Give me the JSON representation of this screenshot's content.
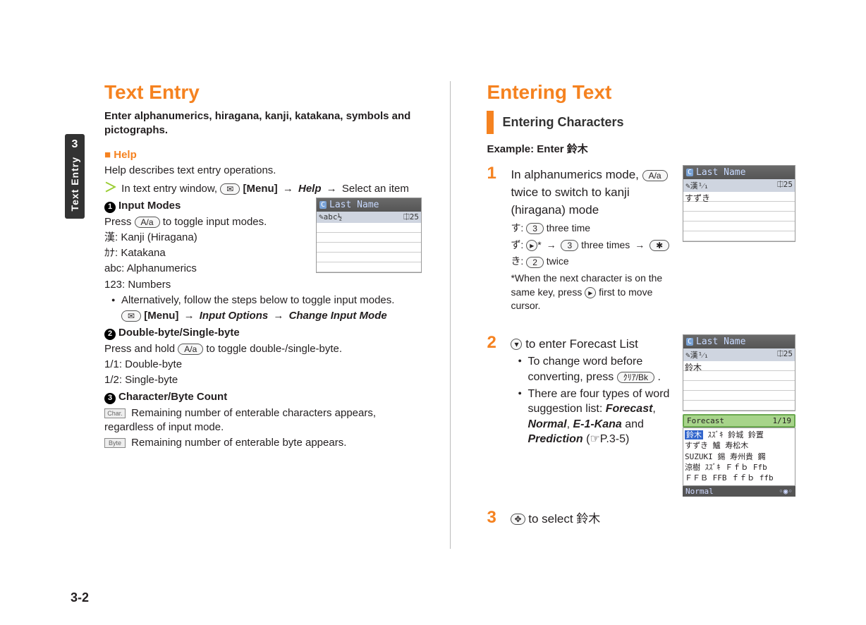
{
  "tab": {
    "chapter_num": "3",
    "chapter_label": "Text Entry"
  },
  "page_number": "3-2",
  "left": {
    "heading": "Text Entry",
    "intro": "Enter alphanumerics, hiragana, kanji, katakana, symbols and pictographs.",
    "help_heading": "Help",
    "help_desc": "Help describes text entry operations.",
    "help_step_prefix": "In text entry window, ",
    "help_step_menu": "[Menu]",
    "help_step_arrow": "→",
    "help_step_help": "Help",
    "help_step_suffix": " Select an item",
    "section1_title": "Input Modes",
    "section1_line1_prefix": "Press ",
    "section1_line1_suffix": " to toggle input modes.",
    "modes": [
      "漢: Kanji (Hiragana)",
      "ｶﾅ: Katakana",
      "abc: Alphanumerics",
      "123: Numbers"
    ],
    "alt_line": "Alternatively, follow the steps below to toggle input modes.",
    "alt_step_menu": "[Menu]",
    "alt_step_opt": "Input Options",
    "alt_step_change": "Change Input Mode",
    "section2_title": "Double-byte/Single-byte",
    "section2_line_prefix": "Press and hold ",
    "section2_line_suffix": " to toggle double-/single-byte.",
    "byte_lines": [
      "1/1: Double-byte",
      "1/2: Single-byte"
    ],
    "section3_title": "Character/Byte Count",
    "char_icon": "Char.",
    "char_line": "Remaining number of enterable characters appears, regardless of input mode.",
    "byte_icon": "Byte",
    "byte_line": "Remaining number of enterable byte appears.",
    "mini": {
      "title": "Last Name",
      "sub_left": "✎abc½",
      "sub_right": "⎅25"
    }
  },
  "right": {
    "heading": "Entering Text",
    "section_bar": "Entering Characters",
    "example": "Example: Enter 鈴木",
    "step1": {
      "num": "1",
      "main_prefix": "In alphanumerics mode, ",
      "main_suffix": " twice to switch to kanji (hiragana) mode",
      "sub_lines": {
        "su": {
          "char": "す: ",
          "key": "3",
          "text": " three time"
        },
        "zu": {
          "char": "ず: ",
          "key1_note": "*",
          "arrow": "→",
          "key2": "3",
          "text_mid": " three times ",
          "key3": "✱"
        },
        "ki": {
          "char": "き: ",
          "key": "2",
          "text": " twice"
        },
        "note": "*When the next character is on the same key, press ",
        "note_suffix": " first to move cursor."
      },
      "mini": {
        "title": "Last Name",
        "sub_left": "✎漢¹⁄₁",
        "sub_right": "⎅25",
        "typed": "すずき"
      }
    },
    "step2": {
      "num": "2",
      "main_suffix": " to enter Forecast List",
      "bullets": [
        {
          "pre": "To change word before converting, press ",
          "key": "ｸﾘｱ/Bk",
          "post": "."
        },
        {
          "text_pre": "There are four types of word suggestion list: ",
          "b1": "Forecast",
          "b2": "Normal",
          "b3": "E-1-Kana",
          "b4": "Prediction",
          "post": " (☞P.3-5)"
        }
      ],
      "mini": {
        "title": "Last Name",
        "sub_left": "✎漢¹⁄₁",
        "sub_right": "⎅25",
        "typed": "鈴木",
        "forecast_label": "Forecast",
        "forecast_count": "1/19",
        "forecast_rows": [
          "鈴木 ｽｽﾞｷ 鈴城 鈴置",
          "すずき 鱸 寿松木",
          "SUZUKI 錫 寿州貴 鐊",
          "涼樹 ｽｽﾞｷ Ｆｆｂ Ffb",
          "ＦＦＢ FFB ｆｆｂ ffb"
        ],
        "footer": "Normal"
      }
    },
    "step3": {
      "num": "3",
      "main_suffix": " to select 鈴木"
    }
  }
}
